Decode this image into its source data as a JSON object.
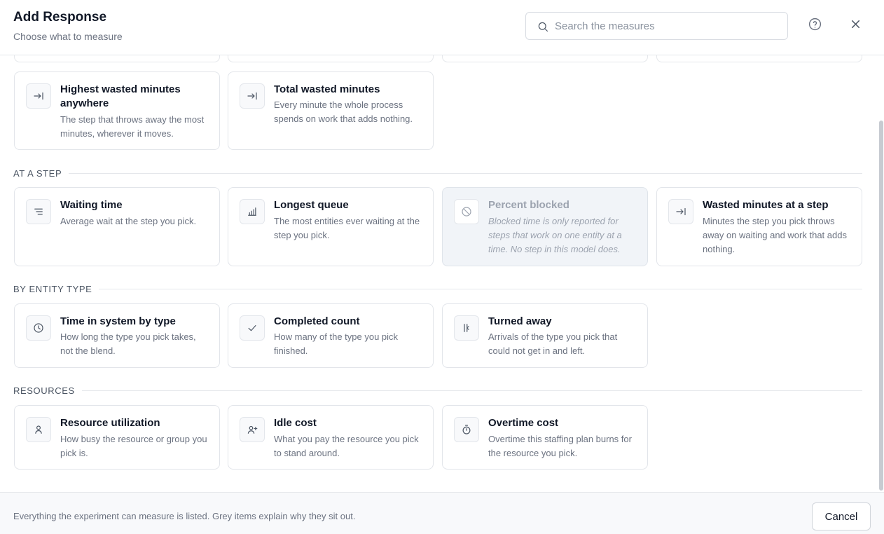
{
  "header": {
    "title": "Add Response",
    "subtitle": "Choose what to measure",
    "search_placeholder": "Search the measures",
    "search_value": ""
  },
  "top_group": {
    "cards": [
      {
        "title": "Highest wasted minutes anywhere",
        "desc": "The step that throws away the most minutes, wherever it moves.",
        "icon": "arrow-right-to-line-icon"
      },
      {
        "title": "Total wasted minutes",
        "desc": "Every minute the whole process spends on work that adds nothing.",
        "icon": "arrow-right-to-line-icon"
      }
    ]
  },
  "sections": [
    {
      "label": "AT A STEP",
      "cards": [
        {
          "title": "Waiting time",
          "desc": "Average wait at the step you pick.",
          "icon": "lines-icon",
          "disabled": false
        },
        {
          "title": "Longest queue",
          "desc": "The most entities ever waiting at the step you pick.",
          "icon": "bar-chart-icon",
          "disabled": false
        },
        {
          "title": "Percent blocked",
          "desc": "Blocked time is only reported for steps that work on one entity at a time. No step in this model does.",
          "icon": "ban-icon",
          "disabled": true
        },
        {
          "title": "Wasted minutes at a step",
          "desc": "Minutes the step you pick throws away on waiting and work that adds nothing.",
          "icon": "arrow-right-to-line-icon",
          "disabled": false
        }
      ]
    },
    {
      "label": "BY ENTITY TYPE",
      "cards": [
        {
          "title": "Time in system by type",
          "desc": "How long the type you pick takes, not the blend.",
          "icon": "clock-icon",
          "disabled": false
        },
        {
          "title": "Completed count",
          "desc": "How many of the type you pick finished.",
          "icon": "check-icon",
          "disabled": false
        },
        {
          "title": "Turned away",
          "desc": "Arrivals of the type you pick that could not get in and left.",
          "icon": "turned-away-icon",
          "disabled": false
        }
      ]
    },
    {
      "label": "RESOURCES",
      "cards": [
        {
          "title": "Resource utilization",
          "desc": "How busy the resource or group you pick is.",
          "icon": "user-icon",
          "disabled": false
        },
        {
          "title": "Idle cost",
          "desc": "What you pay the resource you pick to stand around.",
          "icon": "user-plus-icon",
          "disabled": false
        },
        {
          "title": "Overtime cost",
          "desc": "Overtime this staffing plan burns for the resource you pick.",
          "icon": "timer-icon",
          "disabled": false
        }
      ]
    }
  ],
  "footer": {
    "note": "Everything the experiment can measure is listed. Grey items explain why they sit out.",
    "cancel_label": "Cancel"
  }
}
